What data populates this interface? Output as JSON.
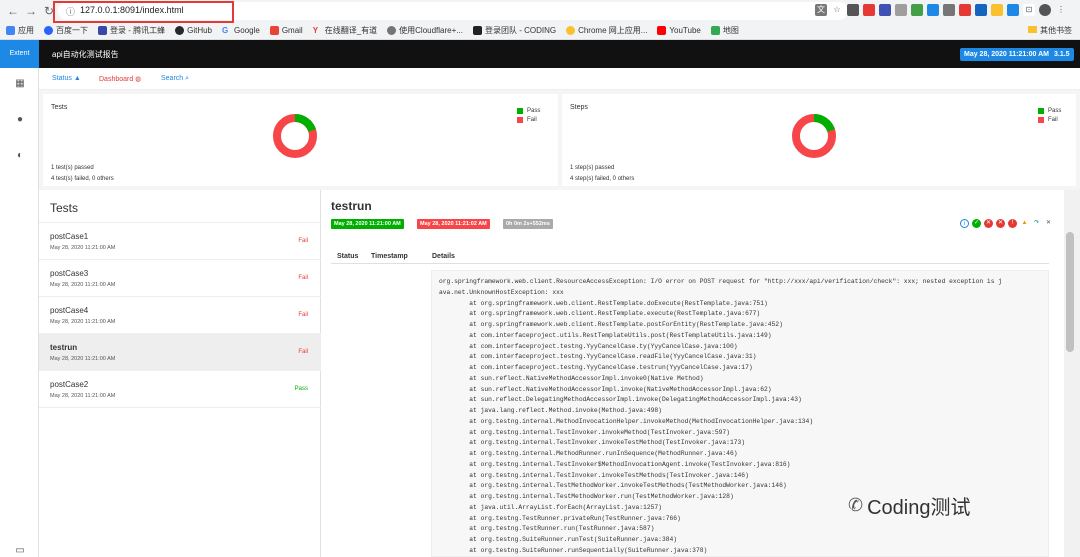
{
  "browser": {
    "url": "127.0.0.1:8091/index.html",
    "bookmarks": [
      "应用",
      "百度一下",
      "登录 - 腾讯工蜂",
      "GitHub",
      "Google",
      "Gmail",
      "在线翻译_有道",
      "使用Cloudflare+...",
      "登录团队 - CODING",
      "Chrome 网上应用...",
      "YouTube",
      "地图"
    ],
    "other_bookmarks": "其他书签"
  },
  "header": {
    "brand": "Extent",
    "title": "api自动化测试报告",
    "date": "May 28, 2020 11:21:00 AM",
    "version": "3.1.5"
  },
  "subnav": {
    "status": "Status",
    "dashboard": "Dashboard",
    "search": "Search"
  },
  "summary": {
    "tests": {
      "title": "Tests",
      "pass_label": "Pass",
      "fail_label": "Fail",
      "passed_text": "1 test(s) passed",
      "failed_text": "4 test(s) failed, 0 others",
      "pass": 1,
      "fail": 4
    },
    "steps": {
      "title": "Steps",
      "pass_label": "Pass",
      "fail_label": "Fail",
      "passed_text": "1 step(s) passed",
      "failed_text": "4 step(s) failed, 0 others",
      "pass": 1,
      "fail": 4
    }
  },
  "tests_panel": {
    "header": "Tests",
    "items": [
      {
        "name": "postCase1",
        "date": "May 28, 2020 11:21:00 AM",
        "status": "Fail"
      },
      {
        "name": "postCase3",
        "date": "May 28, 2020 11:21:00 AM",
        "status": "Fail"
      },
      {
        "name": "postCase4",
        "date": "May 28, 2020 11:21:00 AM",
        "status": "Fail"
      },
      {
        "name": "testrun",
        "date": "May 28, 2020 11:21:00 AM",
        "status": "Fail"
      },
      {
        "name": "postCase2",
        "date": "May 28, 2020 11:21:00 AM",
        "status": "Pass"
      }
    ]
  },
  "detail": {
    "title": "testrun",
    "start": "May 28, 2020 11:21:00 AM",
    "end": "May 28, 2020 11:21:02 AM",
    "duration": "0h 0m 2s+552ms",
    "col_status": "Status",
    "col_timestamp": "Timestamp",
    "col_details": "Details",
    "log": [
      "org.springframework.web.client.ResourceAccessException: I/O error on POST request for \"http://xxx/api/verification/check\": xxx; nested exception is j",
      "ava.net.UnknownHostException: xxx",
      "\tat org.springframework.web.client.RestTemplate.doExecute(RestTemplate.java:751)",
      "\tat org.springframework.web.client.RestTemplate.execute(RestTemplate.java:677)",
      "\tat org.springframework.web.client.RestTemplate.postForEntity(RestTemplate.java:452)",
      "\tat com.interfaceproject.utils.RestTemplateUtils.post(RestTemplateUtils.java:149)",
      "\tat com.interfaceproject.testng.YyyCancelCase.ty(YyyCancelCase.java:100)",
      "\tat com.interfaceproject.testng.YyyCancelCase.readFile(YyyCancelCase.java:31)",
      "\tat com.interfaceproject.testng.YyyCancelCase.testrun(YyyCancelCase.java:17)",
      "\tat sun.reflect.NativeMethodAccessorImpl.invoke0(Native Method)",
      "\tat sun.reflect.NativeMethodAccessorImpl.invoke(NativeMethodAccessorImpl.java:62)",
      "\tat sun.reflect.DelegatingMethodAccessorImpl.invoke(DelegatingMethodAccessorImpl.java:43)",
      "\tat java.lang.reflect.Method.invoke(Method.java:498)",
      "\tat org.testng.internal.MethodInvocationHelper.invokeMethod(MethodInvocationHelper.java:134)",
      "\tat org.testng.internal.TestInvoker.invokeMethod(TestInvoker.java:597)",
      "\tat org.testng.internal.TestInvoker.invokeTestMethod(TestInvoker.java:173)",
      "\tat org.testng.internal.MethodRunner.runInSequence(MethodRunner.java:46)",
      "\tat org.testng.internal.TestInvoker$MethodInvocationAgent.invoke(TestInvoker.java:816)",
      "\tat org.testng.internal.TestInvoker.invokeTestMethods(TestInvoker.java:146)",
      "\tat org.testng.internal.TestMethodWorker.invokeTestMethods(TestMethodWorker.java:146)",
      "\tat org.testng.internal.TestMethodWorker.run(TestMethodWorker.java:128)",
      "\tat java.util.ArrayList.forEach(ArrayList.java:1257)",
      "\tat org.testng.TestRunner.privateRun(TestRunner.java:766)",
      "\tat org.testng.TestRunner.run(TestRunner.java:587)",
      "\tat org.testng.SuiteRunner.runTest(SuiteRunner.java:384)",
      "\tat org.testng.SuiteRunner.runSequentially(SuiteRunner.java:378)"
    ]
  },
  "watermark": "Coding测试",
  "colors": {
    "pass": "#00af00",
    "fail": "#f7464a",
    "accent": "#1e88e5"
  }
}
